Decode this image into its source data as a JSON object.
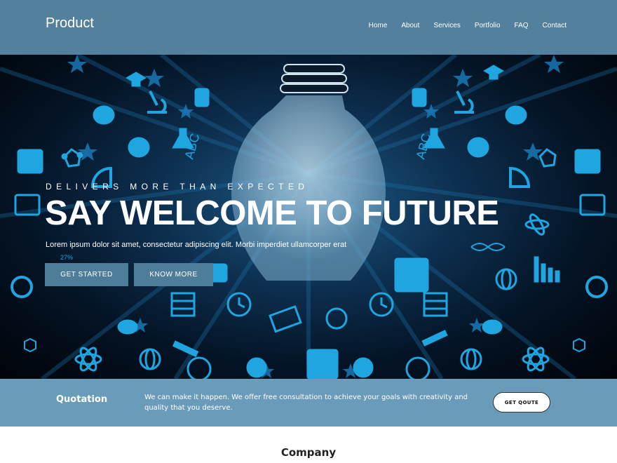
{
  "header": {
    "brand": "Product",
    "nav": [
      "Home",
      "About",
      "Services",
      "Portfolio",
      "FAQ",
      "Contact"
    ]
  },
  "hero": {
    "tagline": "DELIVERS MORE THAN EXPECTED",
    "title": "SAY WELCOME TO FUTURE",
    "description": "Lorem ipsum dolor sit amet, consectetur adipiscing elit. Morbi imperdiet ullamcorper erat",
    "primary_button": "GET STARTED",
    "secondary_button": "KNOW MORE",
    "image_labels": {
      "abc_left": "ABC",
      "abc_right": "ABC",
      "percent": "27%"
    }
  },
  "quotation": {
    "title": "Quotation",
    "text": "We can make it happen. We offer free consultation to achieve your goals with creativity and quality that you deserve.",
    "button": "GET QOUTE"
  },
  "company": {
    "title": "Company"
  },
  "colors": {
    "header_bg": "#53809c",
    "button_bg": "#4e7d9a",
    "quote_bar_bg": "#6a9cba",
    "icon_blue": "#1fa6e0"
  }
}
